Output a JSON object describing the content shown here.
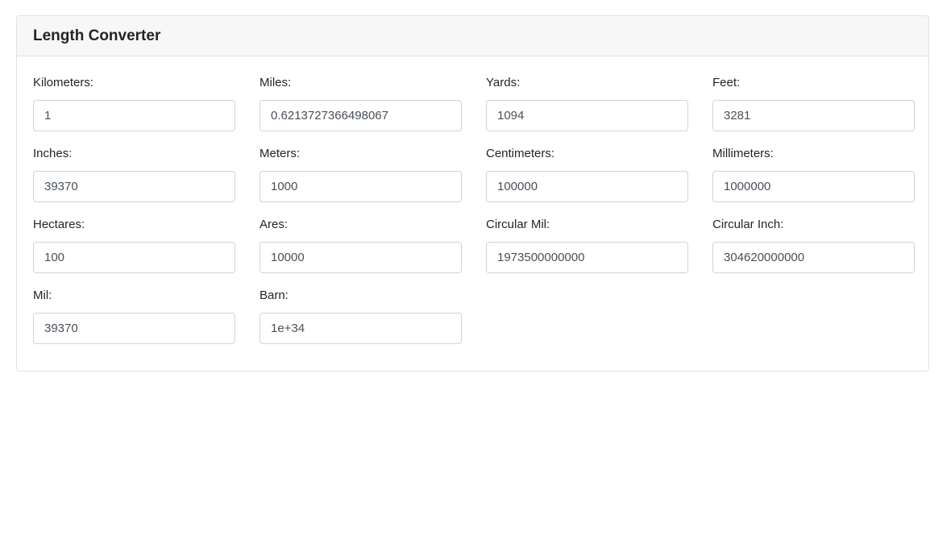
{
  "card": {
    "title": "Length Converter"
  },
  "fields": [
    {
      "label": "Kilometers:",
      "value": "1"
    },
    {
      "label": "Miles:",
      "value": "0.6213727366498067"
    },
    {
      "label": "Yards:",
      "value": "1094"
    },
    {
      "label": "Feet:",
      "value": "3281"
    },
    {
      "label": "Inches:",
      "value": "39370"
    },
    {
      "label": "Meters:",
      "value": "1000"
    },
    {
      "label": "Centimeters:",
      "value": "100000"
    },
    {
      "label": "Millimeters:",
      "value": "1000000"
    },
    {
      "label": "Hectares:",
      "value": "100"
    },
    {
      "label": "Ares:",
      "value": "10000"
    },
    {
      "label": "Circular Mil:",
      "value": "1973500000000"
    },
    {
      "label": "Circular Inch:",
      "value": "304620000000"
    },
    {
      "label": "Mil:",
      "value": "39370"
    },
    {
      "label": "Barn:",
      "value": "1e+34"
    }
  ]
}
